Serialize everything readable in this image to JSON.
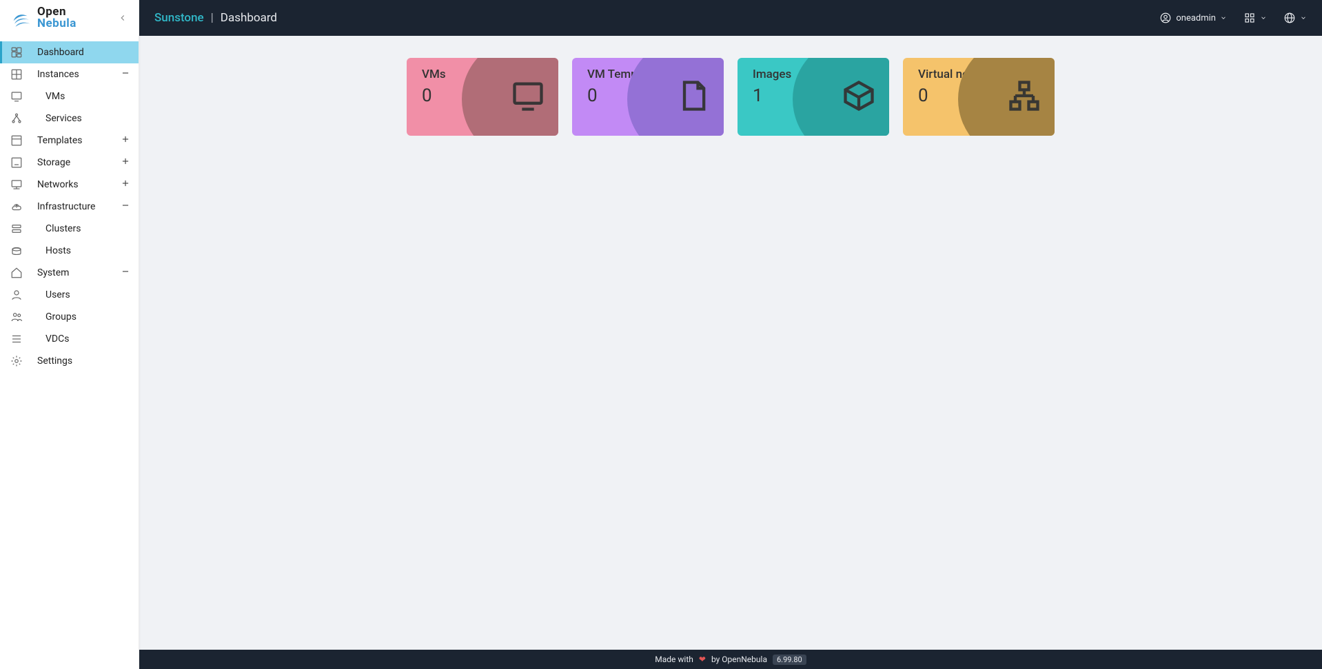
{
  "app": {
    "name": "Sunstone",
    "page": "Dashboard",
    "logo_top": "Open",
    "logo_bottom": "Nebula"
  },
  "header": {
    "user": "oneadmin"
  },
  "sidebar": {
    "items": [
      {
        "label": "Dashboard",
        "icon": "dashboard-icon",
        "active": true
      },
      {
        "label": "Instances",
        "icon": "instances-icon",
        "expand": "minus",
        "children": [
          {
            "label": "VMs",
            "icon": "monitor-icon"
          },
          {
            "label": "Services",
            "icon": "services-icon"
          }
        ]
      },
      {
        "label": "Templates",
        "icon": "templates-icon",
        "expand": "plus"
      },
      {
        "label": "Storage",
        "icon": "storage-icon",
        "expand": "plus"
      },
      {
        "label": "Networks",
        "icon": "networks-icon",
        "expand": "plus"
      },
      {
        "label": "Infrastructure",
        "icon": "infrastructure-icon",
        "expand": "minus",
        "children": [
          {
            "label": "Clusters",
            "icon": "clusters-icon"
          },
          {
            "label": "Hosts",
            "icon": "hosts-icon"
          }
        ]
      },
      {
        "label": "System",
        "icon": "system-icon",
        "expand": "minus",
        "children": [
          {
            "label": "Users",
            "icon": "user-icon"
          },
          {
            "label": "Groups",
            "icon": "groups-icon"
          },
          {
            "label": "VDCs",
            "icon": "vdcs-icon"
          }
        ]
      },
      {
        "label": "Settings",
        "icon": "settings-icon"
      }
    ]
  },
  "dashboard": {
    "cards": [
      {
        "title": "VMs",
        "value": "0",
        "kind": "vms",
        "icon": "monitor-icon"
      },
      {
        "title": "VM Templates",
        "value": "0",
        "kind": "tmpl",
        "icon": "file-icon"
      },
      {
        "title": "Images",
        "value": "1",
        "kind": "img",
        "icon": "package-icon"
      },
      {
        "title": "Virtual networks",
        "value": "0",
        "kind": "net",
        "icon": "network-tree-icon"
      }
    ]
  },
  "footer": {
    "text_before": "Made with",
    "text_after": "by OpenNebula",
    "version": "6.99.80"
  },
  "colors": {
    "accent": "#31b8c8",
    "topbar": "#1b2431",
    "sidebar_active": "#8fd7ee"
  }
}
